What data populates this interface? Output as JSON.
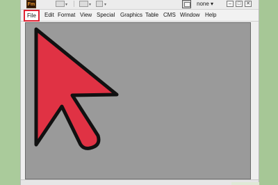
{
  "window": {
    "app_logo_text": "Fm",
    "workspace_select_value": "none",
    "workspace_select_caret": "▾",
    "win_min": "–",
    "win_max": "□",
    "win_close": "✕"
  },
  "menubar": {
    "items": [
      "File",
      "Edit",
      "Format",
      "View",
      "Special",
      "Graphics",
      "Table",
      "CMS",
      "Window",
      "Help"
    ]
  },
  "colors": {
    "highlight_border": "#e02233",
    "cursor_fill": "#e03244",
    "cursor_outline": "#111111",
    "background": "#a9c99a"
  },
  "icons": {
    "cursor": "mouse-pointer-arrow-icon"
  }
}
